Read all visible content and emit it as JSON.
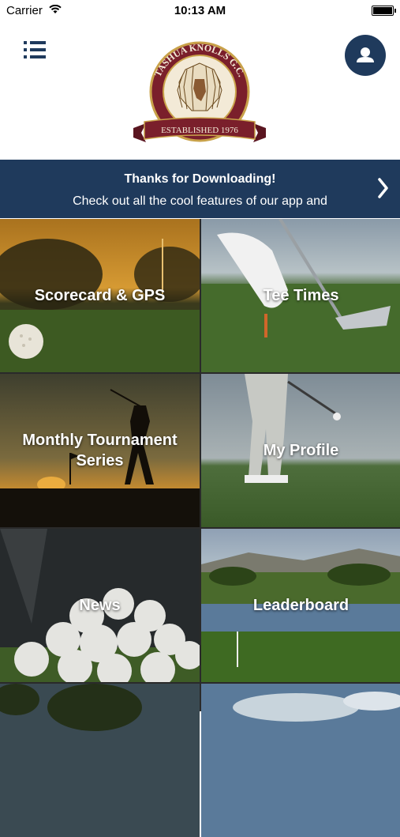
{
  "status_bar": {
    "carrier": "Carrier",
    "time": "10:13 AM"
  },
  "header": {
    "logo": {
      "top_text": "TASHUA KNOLLS G.C.",
      "ribbon_text": "ESTABLISHED 1976"
    },
    "menu_icon": "list-icon",
    "profile_icon": "user-icon"
  },
  "banner": {
    "title": "Thanks for Downloading!",
    "subtitle": "Check out all the cool features of our app and",
    "chevron_icon": "chevron-right-icon"
  },
  "tiles": [
    {
      "label": "Scorecard & GPS"
    },
    {
      "label": "Tee Times"
    },
    {
      "label": "Monthly Tournament Series"
    },
    {
      "label": "My Profile"
    },
    {
      "label": "News"
    },
    {
      "label": "Leaderboard"
    },
    {
      "label": ""
    },
    {
      "label": ""
    }
  ],
  "colors": {
    "navy": "#1f3a5c",
    "maroon": "#7a1f2b",
    "gold": "#c9a24a"
  }
}
